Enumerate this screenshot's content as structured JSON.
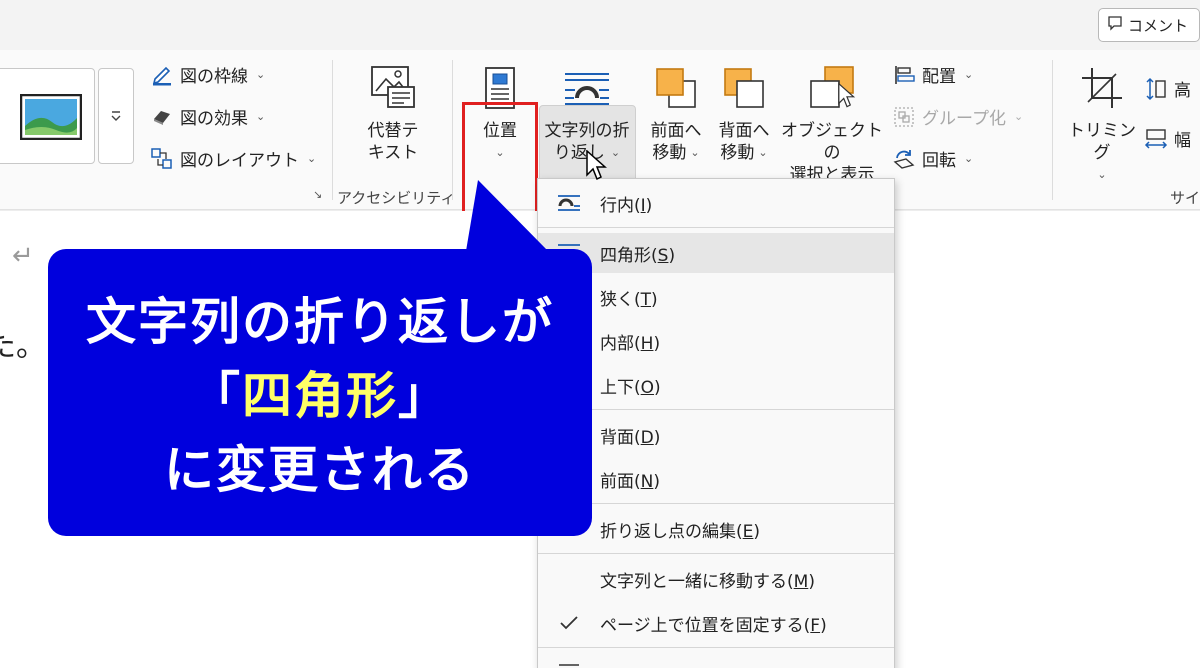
{
  "topbar": {
    "comment_label": "コメント"
  },
  "ribbon": {
    "picture_styles": {
      "border_label": "図の枠線",
      "effects_label": "図の効果",
      "layout_label": "図のレイアウト"
    },
    "accessibility": {
      "alt_text_line1": "代替テ",
      "alt_text_line2": "キスト",
      "group_label": "アクセシビリティ"
    },
    "arrange": {
      "position_label": "位置",
      "wrap_line1": "文字列の折",
      "wrap_line2": "り返し",
      "bring_forward_line1": "前面へ",
      "bring_forward_line2": "移動",
      "send_backward_line1": "背面へ",
      "send_backward_line2": "移動",
      "selection_pane_line1": "オブジェクトの",
      "selection_pane_line2": "選択と表示",
      "align_label": "配置",
      "group_label": "グループ化",
      "rotate_label": "回転"
    },
    "size": {
      "crop_label": "トリミング",
      "height_label": "高",
      "width_label": "幅",
      "group_label": "サイ"
    }
  },
  "wrap_menu": {
    "items": [
      {
        "label": "行内(",
        "key": "I",
        "close": ")"
      },
      {
        "label": "四角形(",
        "key": "S",
        "close": ")"
      },
      {
        "label": "狭く(",
        "key": "T",
        "close": ")"
      },
      {
        "label": "内部(",
        "key": "H",
        "close": ")"
      },
      {
        "label": "上下(",
        "key": "O",
        "close": ")"
      },
      {
        "label": "背面(",
        "key": "D",
        "close": ")"
      },
      {
        "label": "前面(",
        "key": "N",
        "close": ")"
      },
      {
        "label": "折り返し点の編集(",
        "key": "E",
        "close": ")"
      },
      {
        "label": "文字列と一緒に移動する(",
        "key": "M",
        "close": ")"
      },
      {
        "label": "ページ上で位置を固定する(",
        "key": "F",
        "close": ")"
      }
    ],
    "checked_item": "ページ上で位置を固定する"
  },
  "callout": {
    "line1": "文字列の折り返しが",
    "line2_open": "「",
    "line2_highlight": "四角形",
    "line2_close": "」",
    "line3": "に変更される",
    "highlight_color": "#ffff66",
    "bg_color": "#0000dd"
  },
  "document": {
    "return_mark": "↵",
    "text_fragment": "た。"
  },
  "colors": {
    "highlight_border": "#e02020",
    "icon_orange": "#f7b24a"
  }
}
